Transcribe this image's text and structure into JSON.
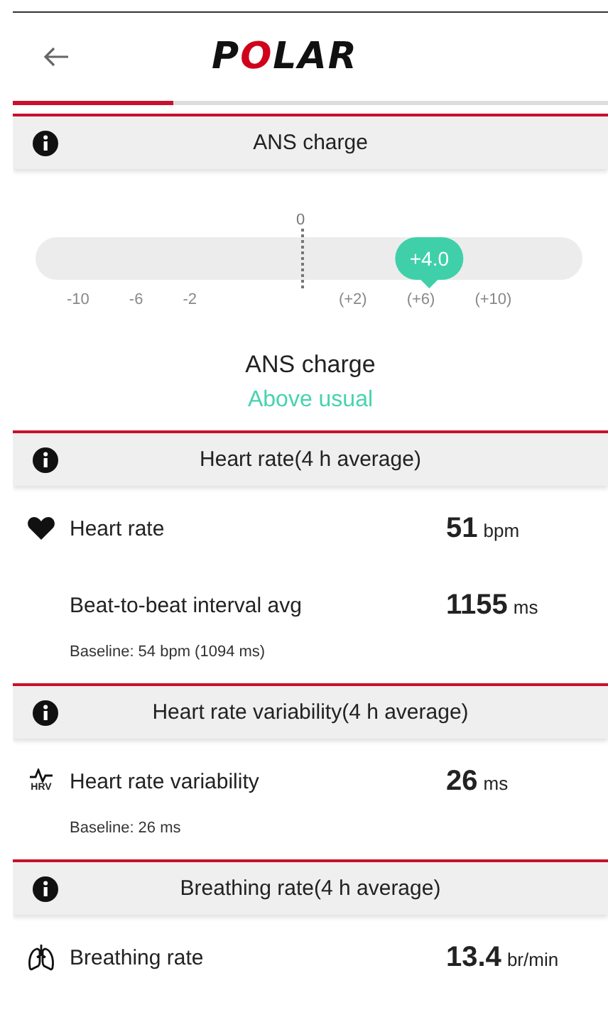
{
  "header": {
    "logo": "POLAR",
    "progress": {
      "level": 0.27
    }
  },
  "ans": {
    "title": "ANS charge",
    "zero_label": "0",
    "marker": {
      "value": "+4.0",
      "level": 0.72
    },
    "scale_labels": [
      "-10",
      "-6",
      "-2",
      "(+2)",
      "(+6)",
      "(+10)"
    ],
    "result_title": "ANS charge",
    "result_status": "Above usual"
  },
  "sections": [
    {
      "title": "Heart rate(4 h average)",
      "rows": [
        {
          "kind": "heart",
          "label": "Heart rate",
          "value": "51",
          "unit": "bpm"
        },
        {
          "kind": "plain",
          "label": "Beat-to-beat interval avg",
          "value": "1155",
          "unit": "ms"
        }
      ],
      "baseline": "Baseline: 54 bpm (1094 ms)"
    },
    {
      "title": "Heart rate variability(4 h average)",
      "rows": [
        {
          "kind": "hrv",
          "label": "Heart rate variability",
          "value": "26",
          "unit": "ms",
          "icon_text": "HRV"
        }
      ],
      "baseline": "Baseline: 26 ms"
    },
    {
      "title": "Breathing rate(4 h average)",
      "rows": [
        {
          "kind": "lungs",
          "label": "Breathing rate",
          "value": "13.4",
          "unit": "br/min"
        }
      ]
    }
  ]
}
